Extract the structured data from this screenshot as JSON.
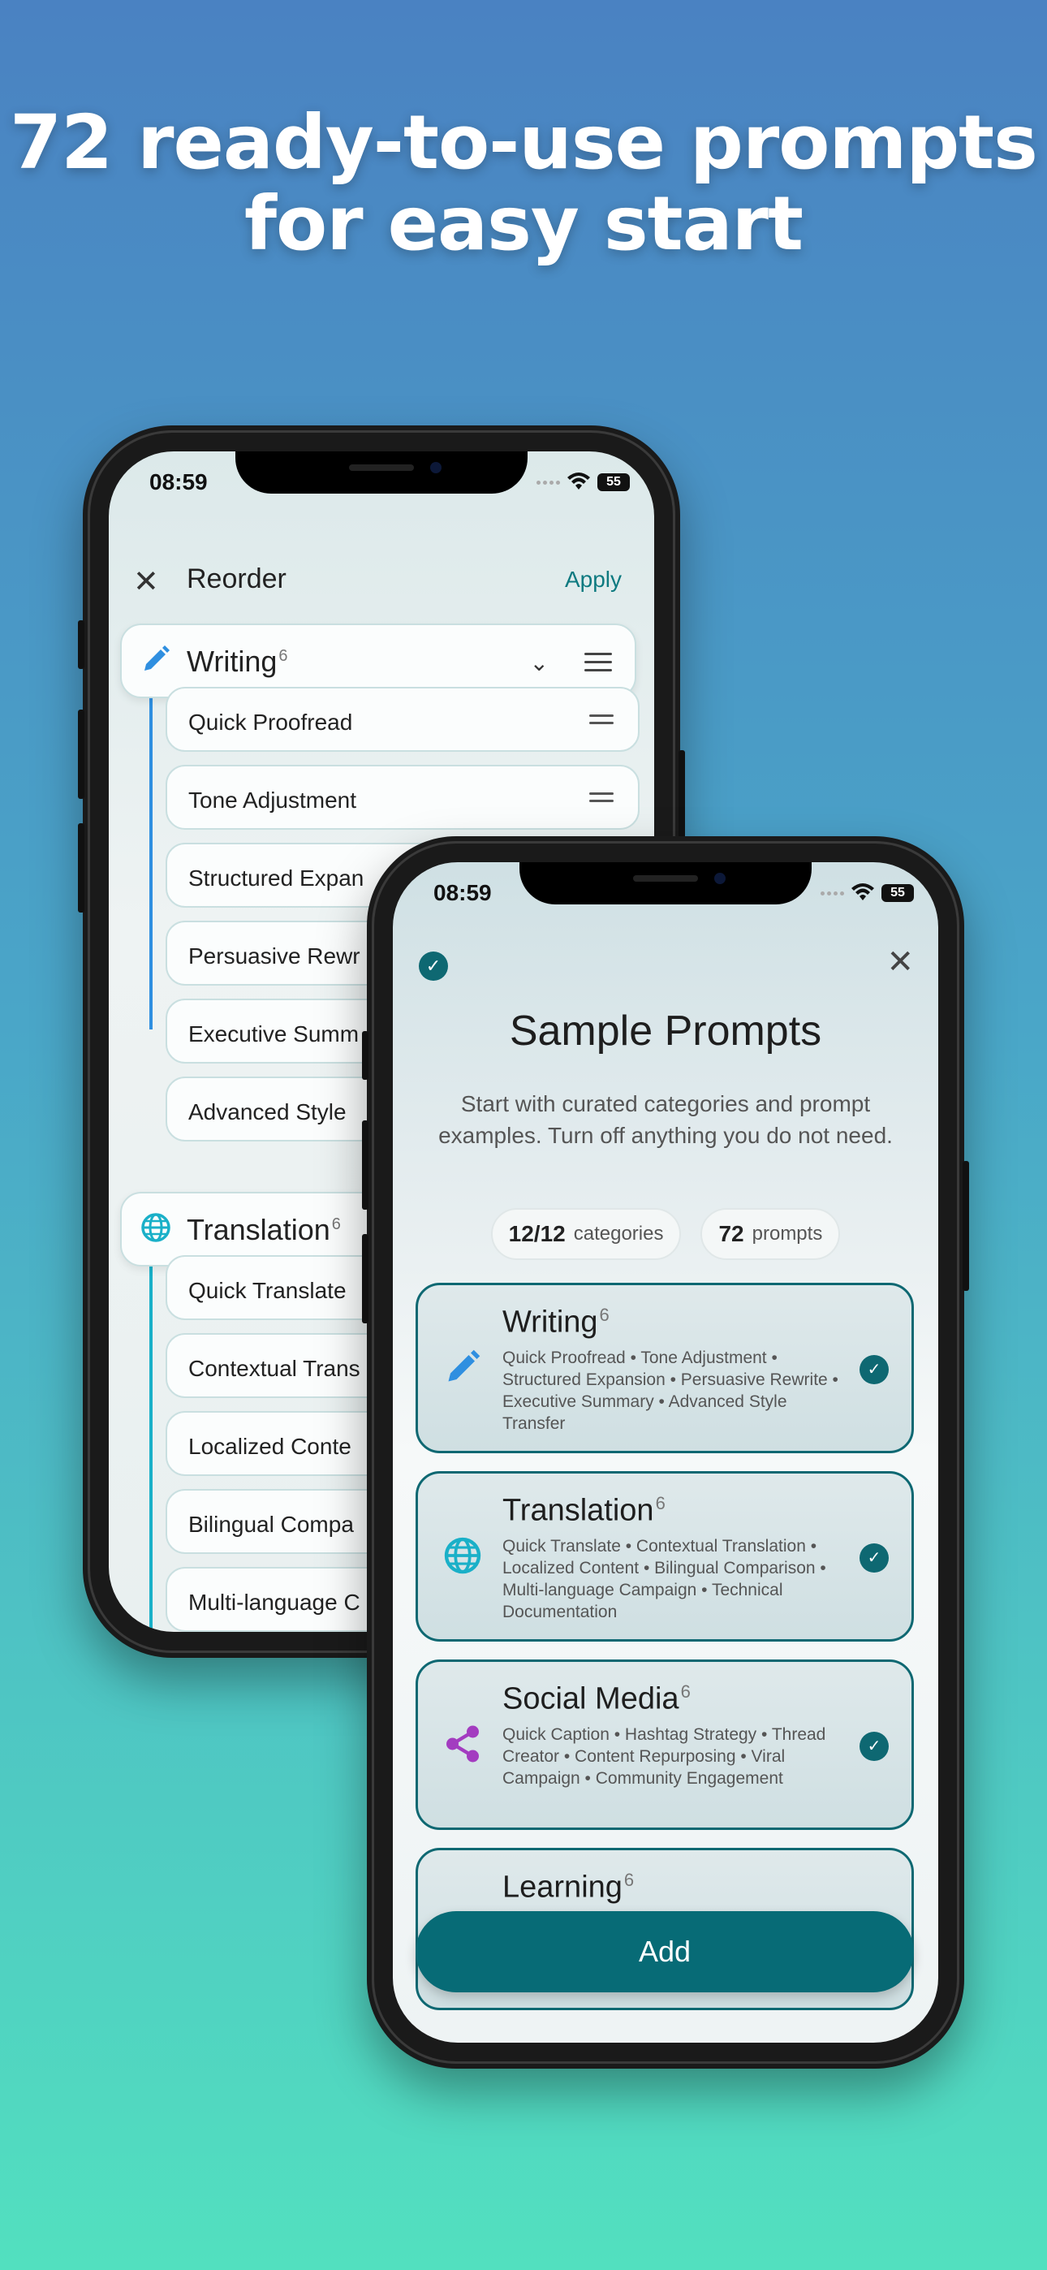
{
  "headline": {
    "line1": "72 ready-to-use prompts",
    "line2": "for easy start"
  },
  "status_bar": {
    "time": "08:59",
    "battery": "55"
  },
  "reorder_screen": {
    "title": "Reorder",
    "apply_label": "Apply",
    "categories": [
      {
        "name": "Writing",
        "count": "6",
        "icon": "pencil-icon",
        "color": "#2f8fe0",
        "items": [
          "Quick Proofread",
          "Tone Adjustment",
          "Structured Expan",
          "Persuasive Rewr",
          "Executive Summ",
          "Advanced Style"
        ]
      },
      {
        "name": "Translation",
        "count": "6",
        "icon": "globe-icon",
        "color": "#1ab0c8",
        "items": [
          "Quick Translate",
          "Contextual Trans",
          "Localized Conte",
          "Bilingual Compa",
          "Multi-language C"
        ]
      }
    ]
  },
  "sample_screen": {
    "title": "Sample Prompts",
    "description": "Start with curated categories and prompt examples. Turn off anything you do not need.",
    "categories_stat": {
      "value": "12/12",
      "label": "categories"
    },
    "prompts_stat": {
      "value": "72",
      "label": "prompts"
    },
    "cards": [
      {
        "name": "Writing",
        "count": "6",
        "icon": "pencil-icon",
        "color": "#2f8fe0",
        "examples": "Quick Proofread • Tone Adjustment • Structured Expansion • Persuasive Rewrite • Executive Summary • Advanced Style Transfer"
      },
      {
        "name": "Translation",
        "count": "6",
        "icon": "globe-icon",
        "color": "#1ab0c8",
        "examples": "Quick Translate • Contextual Translation • Localized Content • Bilingual Comparison • Multi-language Campaign • Technical Documentation"
      },
      {
        "name": "Social Media",
        "count": "6",
        "icon": "share-icon",
        "color": "#a33cc0",
        "examples": "Quick Caption • Hashtag Strategy • Thread Creator • Content Repurposing • Viral Campaign • Community Engagement"
      },
      {
        "name": "Learning",
        "count": "6",
        "icon": "",
        "color": "",
        "examples": ""
      }
    ],
    "add_label": "Add"
  }
}
